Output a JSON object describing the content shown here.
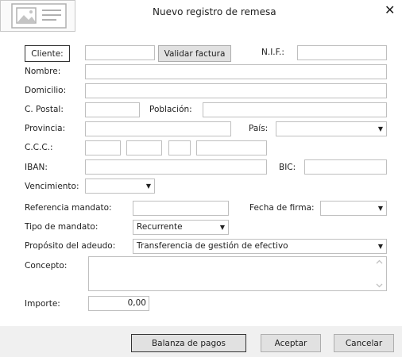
{
  "window": {
    "title": "Nuevo registro de remesa"
  },
  "icons": {
    "logo": "id-card-icon",
    "close": "close-icon"
  },
  "form": {
    "cliente_button": "Cliente:",
    "validar_button": "Validar factura",
    "nif_label": "N.I.F.:",
    "nombre_label": "Nombre:",
    "domicilio_label": "Domicilio:",
    "cpostal_label": "C. Postal:",
    "poblacion_label": "Población:",
    "provincia_label": "Provincia:",
    "pais_label": "País:",
    "ccc_label": "C.C.C.:",
    "iban_label": "IBAN:",
    "bic_label": "BIC:",
    "vencimiento_label": "Vencimiento:",
    "referencia_label": "Referencia mandato:",
    "fecha_firma_label": "Fecha de firma:",
    "tipo_mandato_label": "Tipo de mandato:",
    "tipo_mandato_value": "Recurrente",
    "proposito_label": "Propósito del adeudo:",
    "proposito_value": "Transferencia de gestión de efectivo",
    "concepto_label": "Concepto:",
    "importe_label": "Importe:",
    "importe_value": "0,00"
  },
  "footer": {
    "balanza_button": "Balanza de pagos",
    "aceptar_button": "Aceptar",
    "cancelar_button": "Cancelar"
  }
}
